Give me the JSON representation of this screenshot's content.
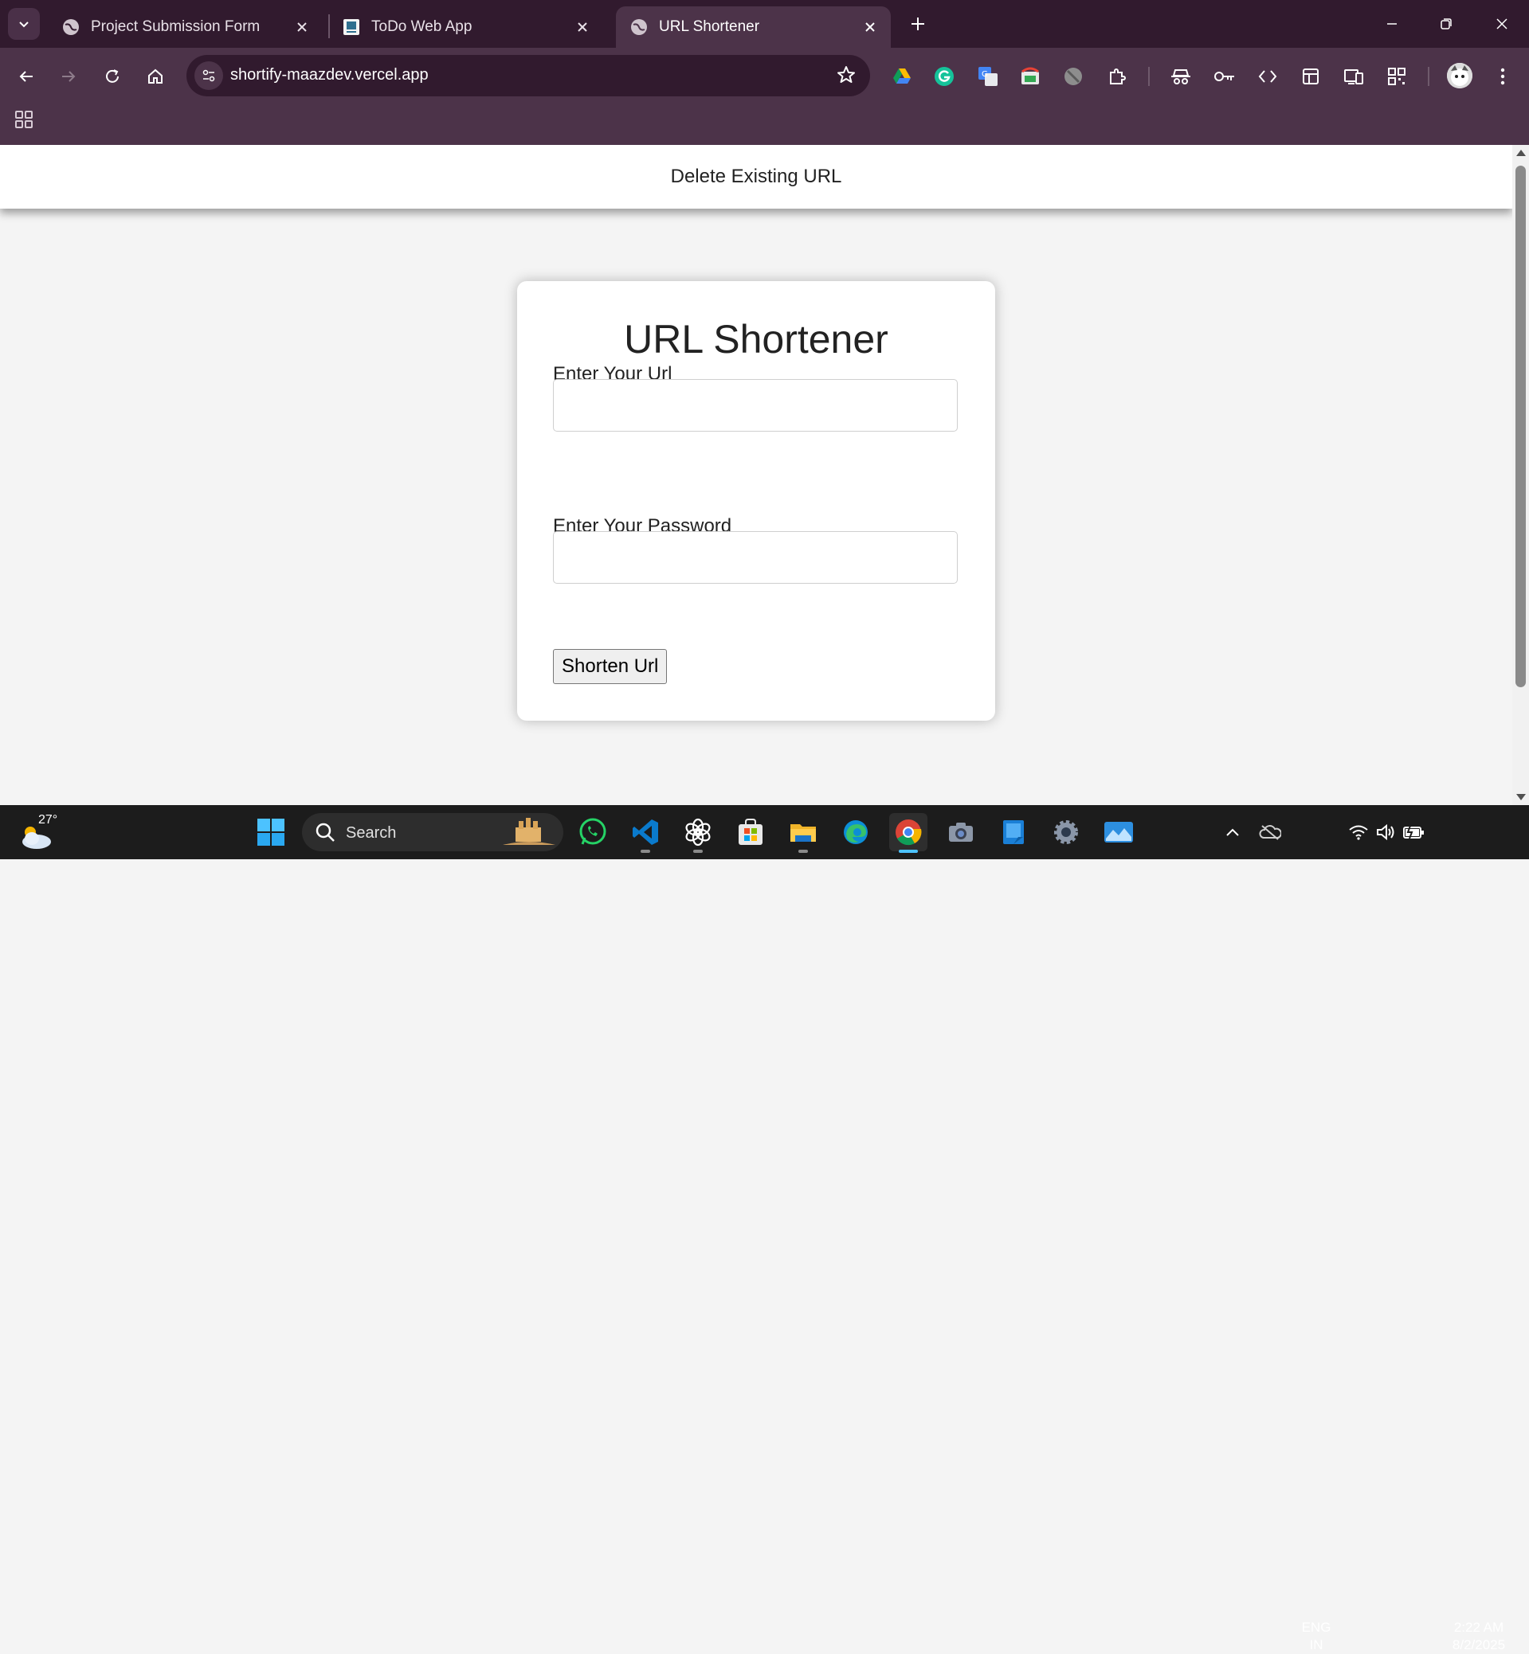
{
  "browser": {
    "tabs": [
      {
        "title": "Project Submission Form",
        "active": false
      },
      {
        "title": "ToDo Web App",
        "active": false
      },
      {
        "title": "URL Shortener",
        "active": true
      }
    ],
    "address": "shortify-maazdev.vercel.app"
  },
  "page": {
    "nav_link": "Delete Existing URL",
    "form": {
      "title": "URL Shortener",
      "url_label": "Enter Your Url",
      "url_value": "",
      "password_label": "Enter Your Password",
      "password_value": "",
      "submit_label": "Shorten Url"
    }
  },
  "taskbar": {
    "weather_temp": "27°",
    "search_placeholder": "Search",
    "apps": [
      "whatsapp",
      "vscode",
      "chatgpt",
      "microsoft-store",
      "file-explorer",
      "edge",
      "chrome",
      "camera",
      "notepad",
      "settings",
      "photos"
    ],
    "language": {
      "line1": "ENG",
      "line2": "IN"
    },
    "time": "2:22 AM",
    "date": "8/2/2025"
  },
  "colors": {
    "tabbar_bg": "#311a2e",
    "toolbar_bg": "#4c3349",
    "page_bg": "#f4f4f4",
    "taskbar_bg": "#1c1c1c",
    "accent": "#4cc2ff"
  }
}
